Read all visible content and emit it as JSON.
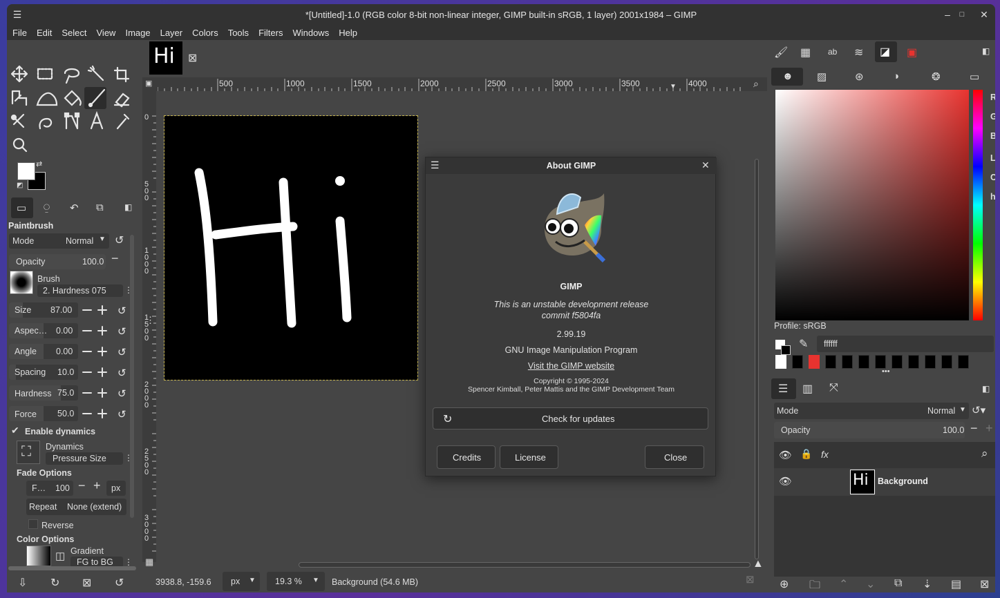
{
  "window": {
    "title": "*[Untitled]-1.0 (RGB color 8-bit non-linear integer, GIMP built-in sRGB, 1 layer) 2001x1984 – GIMP"
  },
  "menu": [
    "File",
    "Edit",
    "Select",
    "View",
    "Image",
    "Layer",
    "Colors",
    "Tools",
    "Filters",
    "Windows",
    "Help"
  ],
  "image_tab": {
    "thumb_text": "Hi"
  },
  "ruler": {
    "h_ticks": [
      "500",
      "1000",
      "1500",
      "2000",
      "2500",
      "3000",
      "3500",
      "4000"
    ],
    "v_labels": [
      "0",
      "5\n0\n0",
      "1\n0\n0\n0",
      "1\n5\n0\n0",
      "2\n0\n0\n0",
      "2\n5\n0\n0",
      "3\n0\n0\n0"
    ]
  },
  "tool_options": {
    "title": "Paintbrush",
    "mode_label": "Mode",
    "mode_value": "Normal",
    "opacity_label": "Opacity",
    "opacity_value": "100.0",
    "brush_label": "Brush",
    "brush_value": "2. Hardness 075",
    "size_label": "Size",
    "size_value": "87.00",
    "aspect_label": "Aspec…",
    "aspect_value": "0.00",
    "angle_label": "Angle",
    "angle_value": "0.00",
    "spacing_label": "Spacing",
    "spacing_value": "10.0",
    "hardness_label": "Hardness",
    "hardness_value": "75.0",
    "force_label": "Force",
    "force_value": "50.0",
    "enable_dynamics": "Enable dynamics",
    "dynamics_label": "Dynamics",
    "dynamics_value": "Pressure Size",
    "fade_title": "Fade Options",
    "fade_label": "F…",
    "fade_value": "100",
    "fade_unit": "px",
    "repeat_label": "Repeat",
    "repeat_value": "None (extend)",
    "reverse_label": "Reverse",
    "color_title": "Color Options",
    "gradient_label": "Gradient",
    "gradient_value": "FG to BG"
  },
  "status": {
    "coords": "3938.8, -159.6",
    "unit": "px",
    "zoom": "19.3 %",
    "message": "Background (54.6 MB)"
  },
  "about": {
    "title": "About GIMP",
    "app": "GIMP",
    "unstable": "This is an unstable development release",
    "commit": "commit f5804fa",
    "version": "2.99.19",
    "program": "GNU Image Manipulation Program",
    "website": "Visit the GIMP website",
    "copyright": "Copyright © 1995-2024",
    "authors": "Spencer Kimball, Peter Mattis and the GIMP Development Team",
    "check_updates": "Check for updates",
    "credits": "Credits",
    "license": "License",
    "close": "Close"
  },
  "color_panel": {
    "channels": [
      "R",
      "G",
      "B",
      "L",
      "C",
      "h"
    ],
    "profile": "Profile: sRGB",
    "hex": "ffffff",
    "accent": "#e8332f"
  },
  "layers": {
    "mode_label": "Mode",
    "mode_value": "Normal",
    "opacity_label": "Opacity",
    "opacity_value": "100.0",
    "layer_thumb": "Hi",
    "layer_name": "Background"
  }
}
